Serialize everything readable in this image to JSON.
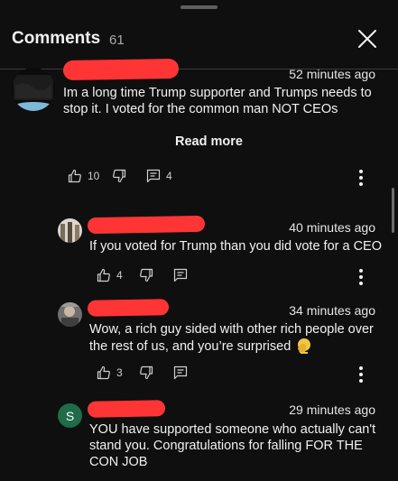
{
  "header": {
    "title": "Comments",
    "count": "61"
  },
  "comments": [
    {
      "time": "52 minutes ago",
      "lines": [
        "Im a long time Trump supporter and Trumps needs to",
        "stop it. I voted for the common man NOT CEOs"
      ],
      "read_more": "Read more",
      "likes": "10",
      "replies": "4"
    },
    {
      "time": "40 minutes ago",
      "lines": [
        "If you voted for Trump than you did vote for a CEO"
      ],
      "likes": "4"
    },
    {
      "time": "34 minutes ago",
      "lines": [
        "Wow, a rich guy sided with other rich people over",
        "the rest of us, and you’re surprised"
      ],
      "emoji": "🤦",
      "likes": "3"
    },
    {
      "time": "29 minutes ago",
      "avatar_letter": "S",
      "lines": [
        "YOU have supported someone who actually can't",
        "stand you. Congratulations for falling FOR THE",
        "CON JOB"
      ]
    }
  ],
  "colors": {
    "background": "#0f0f0f",
    "redaction": "#ff3535",
    "avatar_s": "#1f6b4a"
  },
  "icons": [
    "close-icon",
    "like-icon",
    "dislike-icon",
    "reply-icon",
    "more-options-icon"
  ]
}
